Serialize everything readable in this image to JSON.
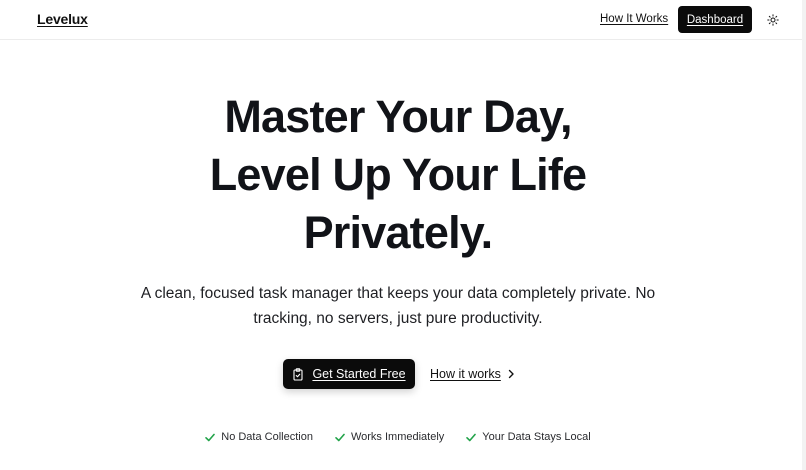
{
  "header": {
    "brand": "Levelux",
    "nav_link": "How It Works",
    "dashboard_label": "Dashboard",
    "theme_icon": "sun-icon"
  },
  "hero": {
    "title_lines": [
      "Master Your Day,",
      "Level Up Your Life",
      "Privately."
    ],
    "subtitle": "A clean, focused task manager that keeps your data completely private. No tracking, no servers, just pure productivity."
  },
  "actions": {
    "primary_label": "Get Started Free",
    "primary_icon": "clipboard-icon",
    "secondary_label": "How it works",
    "secondary_icon": "chevron-right-icon"
  },
  "features": [
    {
      "label": "No Data Collection",
      "icon": "check-icon"
    },
    {
      "label": "Works Immediately",
      "icon": "check-icon"
    },
    {
      "label": "Your Data Stays Local",
      "icon": "check-icon"
    }
  ],
  "colors": {
    "accent_check": "#22a34a",
    "button_bg": "#0b0b0b",
    "text": "#111318"
  }
}
